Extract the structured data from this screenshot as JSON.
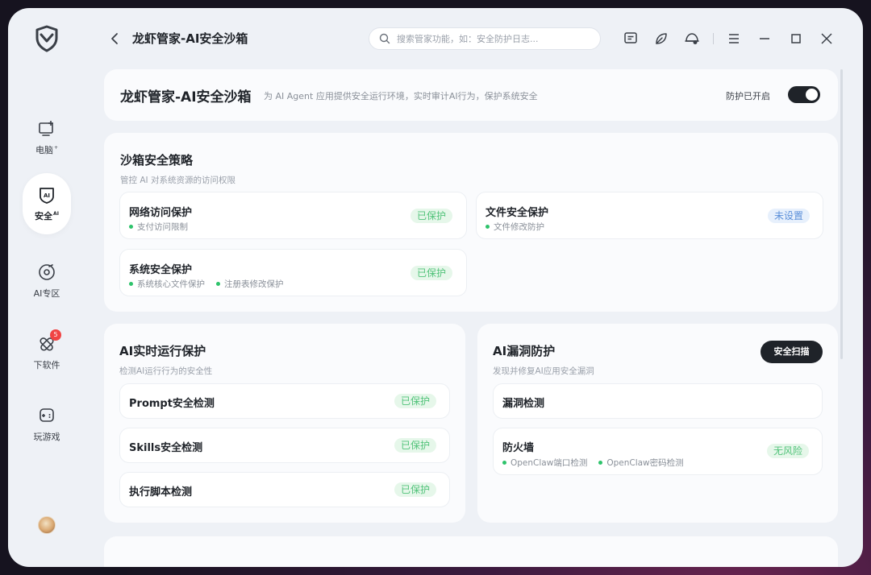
{
  "app": {
    "title": "龙虾管家-AI安全沙箱"
  },
  "sidebar": {
    "items": [
      {
        "label": "电脑",
        "sup": "+",
        "icon": "computer-icon"
      },
      {
        "label": "安全",
        "sup": "AI",
        "icon": "ai-shield-icon",
        "active": true
      },
      {
        "label": "AI专区",
        "icon": "ai-zone-icon"
      },
      {
        "label": "下软件",
        "icon": "download-software-icon",
        "badge": "5"
      },
      {
        "label": "玩游戏",
        "icon": "gamepad-icon"
      }
    ]
  },
  "search": {
    "placeholder": "搜索管家功能，如：安全防护日志..."
  },
  "header": {
    "title": "龙虾管家-AI安全沙箱",
    "description": "为 AI Agent 应用提供安全运行环境，实时审计AI行为，保护系统安全",
    "toggle_label": "防护已开启",
    "toggle_on": true
  },
  "sandbox_policy": {
    "title": "沙箱安全策略",
    "subtitle": "管控 AI 对系统资源的访问权限",
    "items": [
      {
        "title": "网络访问保护",
        "features": [
          "支付访问限制"
        ],
        "status": "已保护",
        "status_color": "#52c37a"
      },
      {
        "title": "文件安全保护",
        "features": [
          "文件修改防护"
        ],
        "status": "未设置",
        "status_color": "#5b8fd9"
      },
      {
        "title": "系统安全保护",
        "features": [
          "系统核心文件保护",
          "注册表修改保护"
        ],
        "status": "已保护",
        "status_color": "#52c37a"
      }
    ]
  },
  "runtime_protection": {
    "title": "AI实时运行保护",
    "subtitle": "检测AI运行行为的安全性",
    "items": [
      {
        "title": "Prompt安全检测",
        "status": "已保护"
      },
      {
        "title": "Skills安全检测",
        "status": "已保护"
      },
      {
        "title": "执行脚本检测",
        "status": "已保护"
      }
    ]
  },
  "vuln_protection": {
    "title": "AI漏洞防护",
    "subtitle": "发现并修复AI应用安全漏洞",
    "scan_button": "安全扫描",
    "items": [
      {
        "title": "漏洞检测"
      },
      {
        "title": "防火墙",
        "features": [
          "OpenClaw端口检测",
          "OpenClaw密码检测"
        ],
        "status": "无风险"
      }
    ]
  },
  "colors": {
    "accent_dark": "#1f2329",
    "protected_green": "#52c37a",
    "unset_blue": "#5b8fd9",
    "badge_red": "#f04444"
  }
}
